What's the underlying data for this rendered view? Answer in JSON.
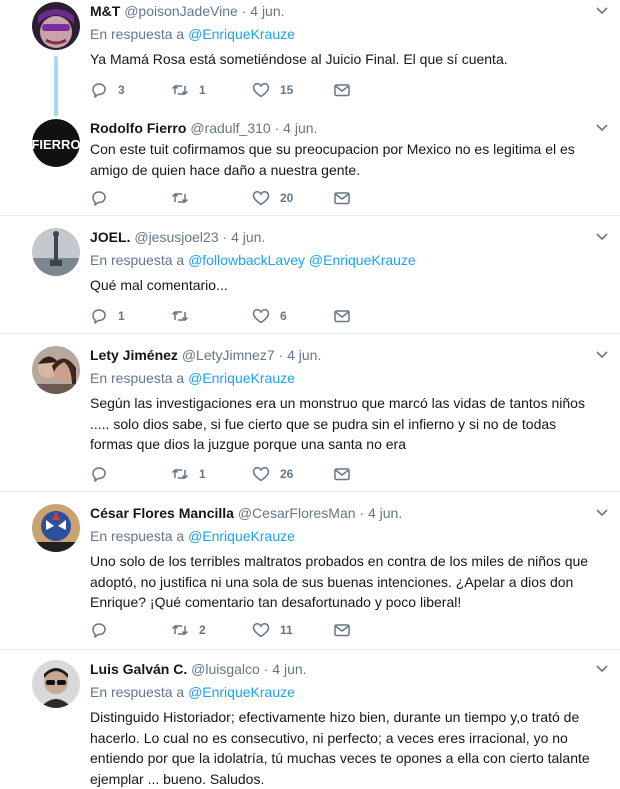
{
  "common": {
    "replying_label": "En respuesta a"
  },
  "tweets": [
    {
      "name": "M&T",
      "handle": "@poisonJadeVine",
      "time": "4 jun.",
      "reply_to": [
        "@EnriqueKrauze"
      ],
      "text": [
        "Ya Mamá Rosa está sometiéndose al Juicio Final. El que sí cuenta."
      ],
      "replies": "3",
      "retweets": "1",
      "likes": "15",
      "avatar_color": "#3d2c4a"
    },
    {
      "name": "Rodolfo Fierro",
      "handle": "@radulf_310",
      "time": "4 jun.",
      "reply_to": [],
      "text": [
        "Con este tuit cofirmamos que su preocupacion por Mexico no es legitima el es",
        "amigo de quien hace daño a nuestra gente."
      ],
      "replies": "",
      "retweets": "",
      "likes": "20",
      "avatar_text": "FIERRO",
      "avatar_color": "#111111"
    },
    {
      "name": "JOEL.",
      "handle": "@jesusjoel23",
      "time": "4 jun.",
      "reply_to": [
        "@followbackLavey",
        "@EnriqueKrauze"
      ],
      "text": [
        "Qué mal comentario..."
      ],
      "replies": "1",
      "retweets": "",
      "likes": "6",
      "avatar_color": "#9aa3ad"
    },
    {
      "name": "Lety Jiménez",
      "handle": "@LetyJimnez7",
      "time": "4 jun.",
      "reply_to": [
        "@EnriqueKrauze"
      ],
      "text": [
        "Según las investigaciones era un monstruo que marcó las vidas de tantos niños",
        "..... solo dios sabe, si fue cierto que se pudra sin el infierno y si no de todas",
        "formas que dios la juzgue porque una santa no era"
      ],
      "replies": "",
      "retweets": "1",
      "likes": "26",
      "avatar_color": "#a27e6a"
    },
    {
      "name": "César Flores Mancilla",
      "handle": "@CesarFloresMan",
      "time": "4 jun.",
      "reply_to": [
        "@EnriqueKrauze"
      ],
      "text": [
        "Uno solo de los terribles maltratos probados en contra de los miles de niños que",
        "adoptó, no justifica ni una sola de sus buenas intenciones. ¿Apelar a dios don",
        "Enrique? ¡Qué comentario tan desafortunado y poco liberal!"
      ],
      "replies": "",
      "retweets": "2",
      "likes": "11",
      "avatar_color": "#3d5fa8"
    },
    {
      "name": "Luis Galván C.",
      "handle": "@luisgalco",
      "time": "4 jun.",
      "reply_to": [
        "@EnriqueKrauze"
      ],
      "text": [
        "Distinguido Historiador; efectivamente hizo bien, durante un tiempo y,o trató de",
        "hacerlo. Lo cual no es consecutivo, ni perfecto; a veces eres irracional, yo no",
        "entiendo por que la idolatría, tú muchas veces te opones a ella con cierto talante",
        "ejemplar ... bueno. Saludos."
      ],
      "replies": "",
      "retweets": "",
      "likes": "",
      "avatar_color": "#2b2b2b"
    }
  ]
}
